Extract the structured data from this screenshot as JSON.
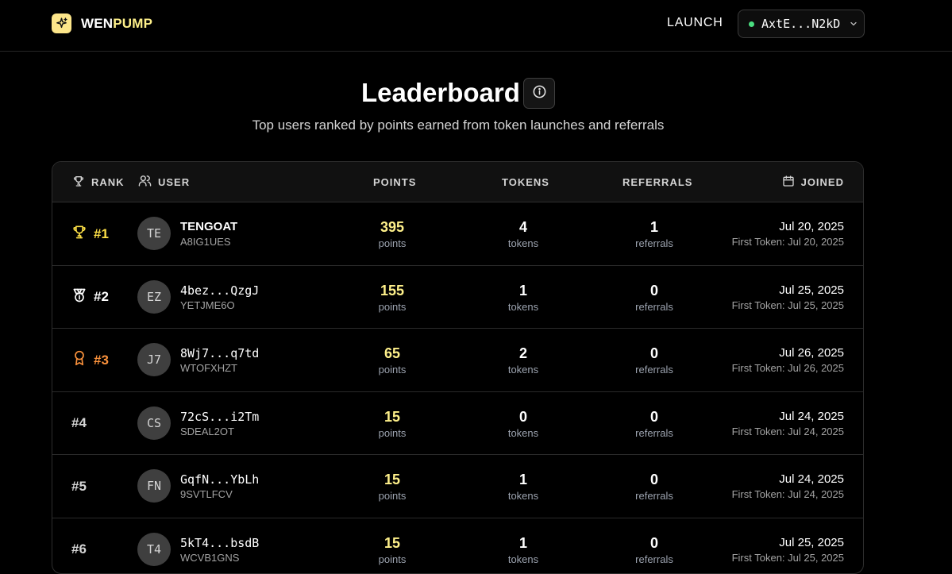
{
  "nav": {
    "brand_part1": "WEN",
    "brand_part2": "PUMP",
    "launch_label": "LAUNCH",
    "wallet_address": "AxtE...N2kD",
    "wallet_status_color": "#4ade80",
    "icons": {
      "logo": "sparkle-icon",
      "wallet_chevron": "chevron-down-icon"
    }
  },
  "header": {
    "title": "Leaderboard",
    "info_icon": "info-icon",
    "subtitle": "Top users ranked by points earned from token launches and referrals"
  },
  "table": {
    "columns": {
      "rank": "RANK",
      "user": "USER",
      "points": "POINTS",
      "tokens": "TOKENS",
      "referrals": "REFERRALS",
      "joined": "JOINED"
    },
    "column_icons": {
      "rank": "trophy-icon",
      "user": "users-icon",
      "joined": "calendar-icon"
    },
    "unit_labels": {
      "points": "points",
      "tokens": "tokens",
      "referrals": "referrals"
    },
    "first_token_prefix": "First Token: ",
    "rows": [
      {
        "rank": "#1",
        "rank_icon": "trophy-icon",
        "rank_color": "#fde047",
        "initials": "TE",
        "name": "TENGOAT",
        "name_mono": false,
        "code": "A8IG1UES",
        "points": "395",
        "tokens": "4",
        "referrals": "1",
        "joined": "Jul 20, 2025",
        "first_token": "Jul 20, 2025"
      },
      {
        "rank": "#2",
        "rank_icon": "medal-icon",
        "rank_color": "#ffffff",
        "initials": "EZ",
        "name": "4bez...QzgJ",
        "name_mono": true,
        "code": "YETJME6O",
        "points": "155",
        "tokens": "1",
        "referrals": "0",
        "joined": "Jul 25, 2025",
        "first_token": "Jul 25, 2025"
      },
      {
        "rank": "#3",
        "rank_icon": "award-icon",
        "rank_color": "#fb923c",
        "initials": "J7",
        "name": "8Wj7...q7td",
        "name_mono": true,
        "code": "WTOFXHZT",
        "points": "65",
        "tokens": "2",
        "referrals": "0",
        "joined": "Jul 26, 2025",
        "first_token": "Jul 26, 2025"
      },
      {
        "rank": "#4",
        "rank_icon": "",
        "rank_color": "#d4d4d4",
        "initials": "CS",
        "name": "72cS...i2Tm",
        "name_mono": true,
        "code": "SDEAL2OT",
        "points": "15",
        "tokens": "0",
        "referrals": "0",
        "joined": "Jul 24, 2025",
        "first_token": "Jul 24, 2025"
      },
      {
        "rank": "#5",
        "rank_icon": "",
        "rank_color": "#d4d4d4",
        "initials": "FN",
        "name": "GqfN...YbLh",
        "name_mono": true,
        "code": "9SVTLFCV",
        "points": "15",
        "tokens": "1",
        "referrals": "0",
        "joined": "Jul 24, 2025",
        "first_token": "Jul 24, 2025"
      },
      {
        "rank": "#6",
        "rank_icon": "",
        "rank_color": "#d4d4d4",
        "initials": "T4",
        "name": "5kT4...bsdB",
        "name_mono": true,
        "code": "WCVB1GNS",
        "points": "15",
        "tokens": "1",
        "referrals": "0",
        "joined": "Jul 25, 2025",
        "first_token": "Jul 25, 2025"
      }
    ]
  }
}
